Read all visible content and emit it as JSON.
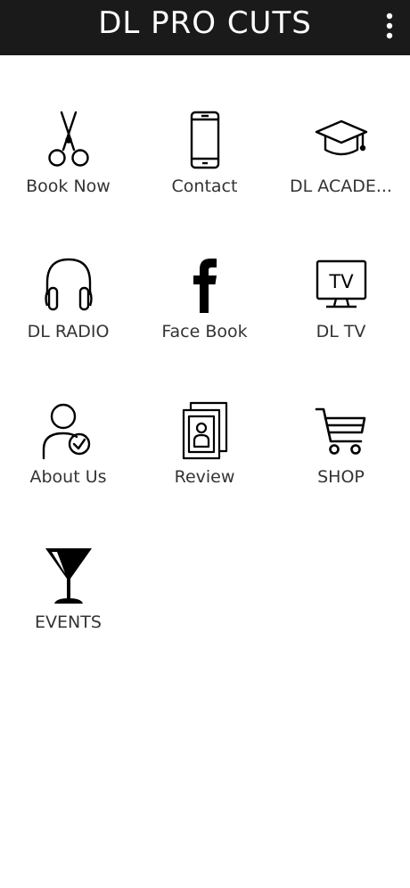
{
  "header": {
    "title": "DL PRO CUTS",
    "menu_icon": "more-vertical-icon",
    "background": "#1a1a1a",
    "title_color": "#ffffff"
  },
  "grid": {
    "items": [
      {
        "label": "Book Now",
        "icon": "scissors-icon"
      },
      {
        "label": "Contact",
        "icon": "smartphone-icon"
      },
      {
        "label": "DL ACADE...",
        "icon": "graduation-cap-icon"
      },
      {
        "label": "DL RADIO",
        "icon": "headphones-icon"
      },
      {
        "label": "Face Book",
        "icon": "facebook-icon"
      },
      {
        "label": "DL TV",
        "icon": "tv-icon"
      },
      {
        "label": "About Us",
        "icon": "user-check-icon"
      },
      {
        "label": "Review",
        "icon": "photo-cards-icon"
      },
      {
        "label": "SHOP",
        "icon": "shopping-cart-icon"
      },
      {
        "label": "EVENTS",
        "icon": "cocktail-icon"
      }
    ]
  }
}
